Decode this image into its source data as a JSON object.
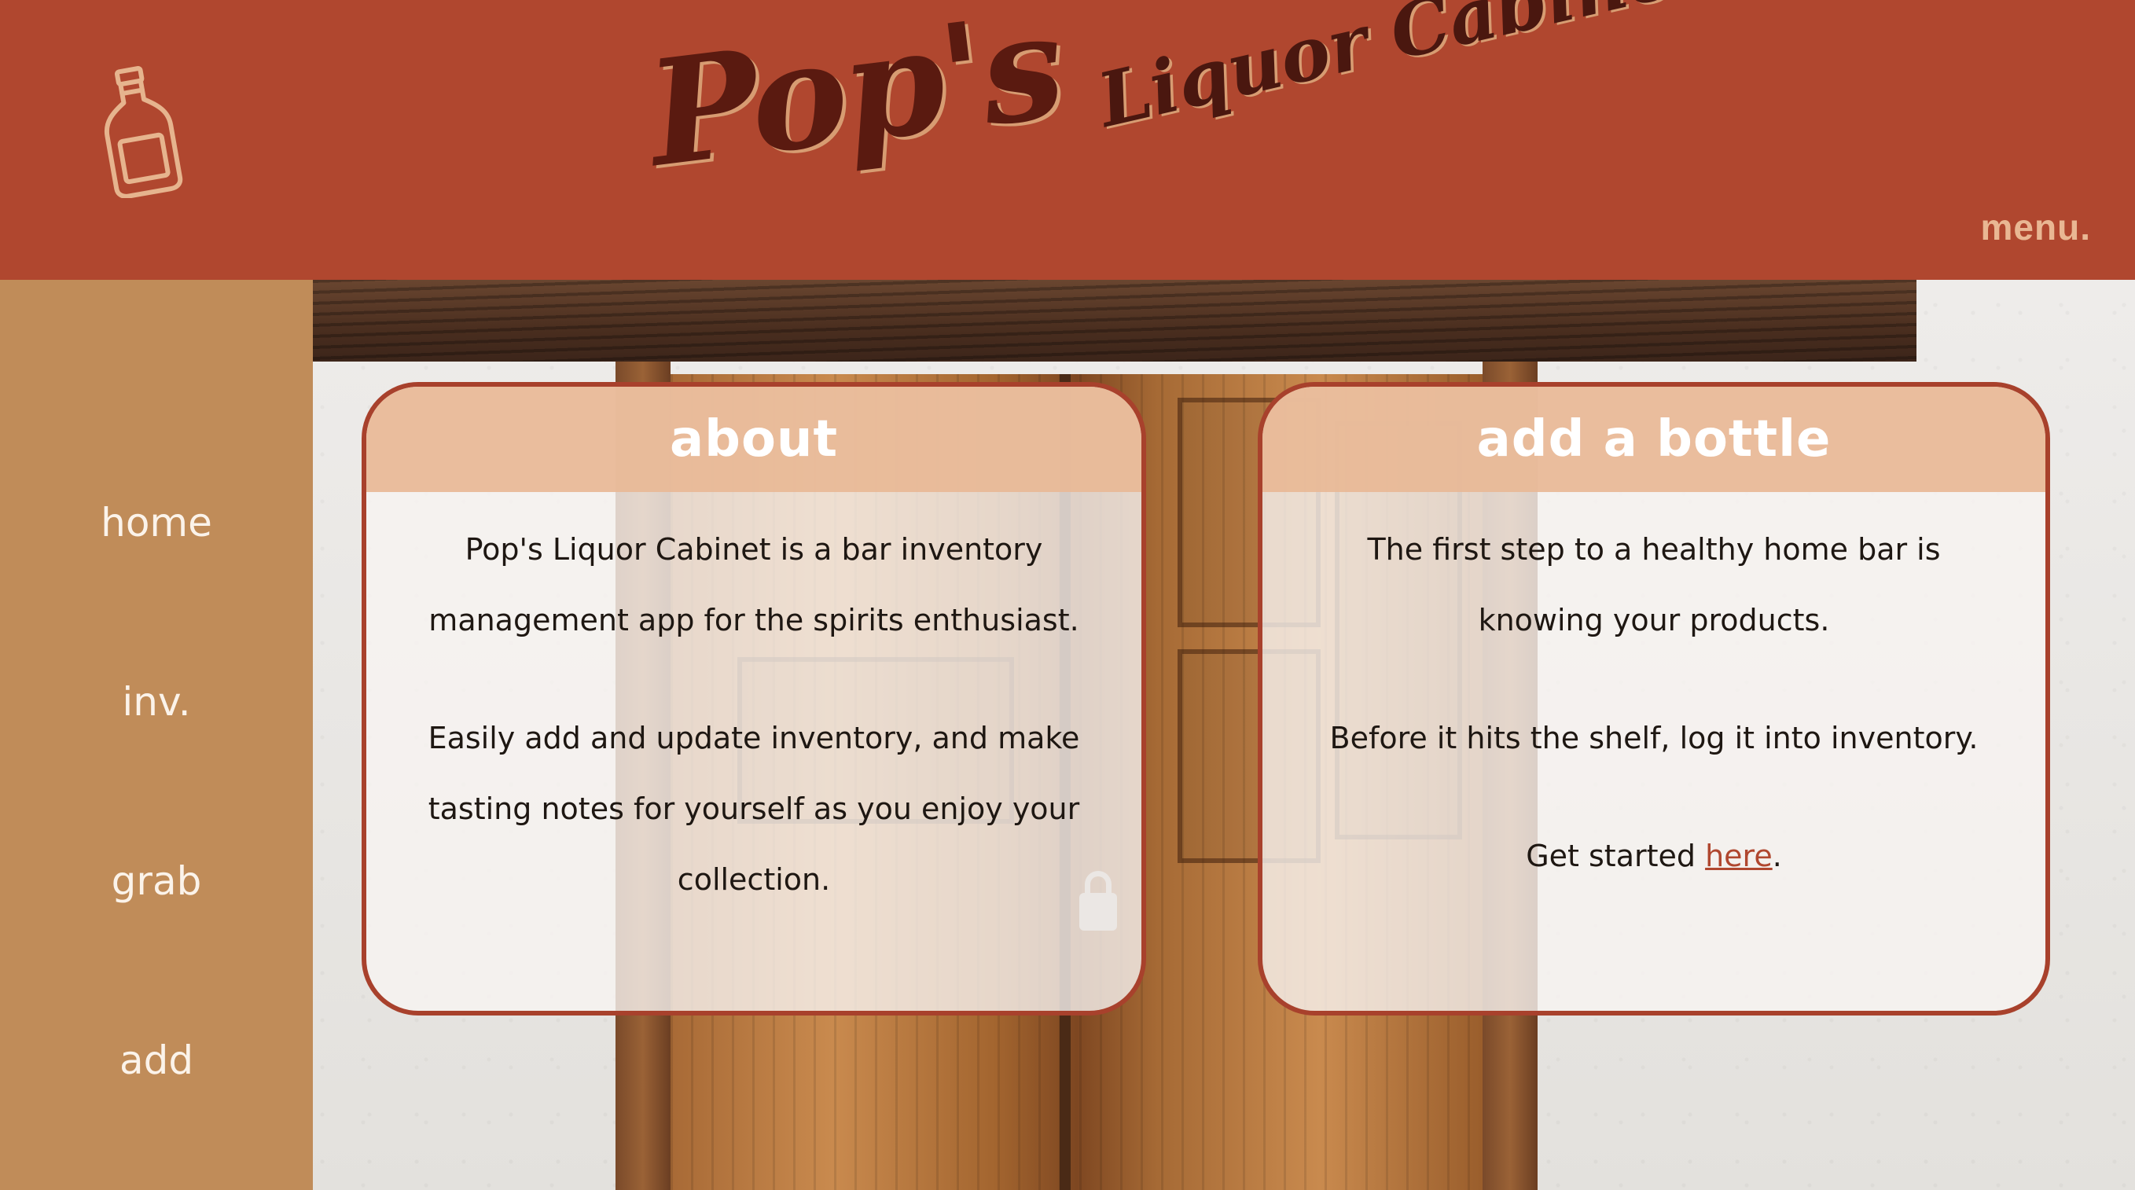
{
  "header": {
    "brand_main": "Pop's",
    "brand_sub": "Liquor Cabinet",
    "menu_label": "menu.",
    "logo_icon": "liquor-bottle-icon"
  },
  "sidebar": {
    "items": [
      {
        "label": "home"
      },
      {
        "label": "inv."
      },
      {
        "label": "grab"
      },
      {
        "label": "add"
      }
    ]
  },
  "cards": {
    "about": {
      "title": "about",
      "paragraphs": [
        "Pop's Liquor Cabinet is a bar inventory management app for the spirits enthusiast.",
        "Easily add and update inventory, and make tasting notes for yourself as you enjoy your collection."
      ]
    },
    "add": {
      "title": "add a bottle",
      "paragraphs": [
        "The first step to a healthy home bar is knowing your products.",
        "Before it hits the shelf, log it into inventory."
      ],
      "cta_prefix": "Get started ",
      "cta_link": "here",
      "cta_suffix": "."
    }
  },
  "colors": {
    "header_bg": "#b0472f",
    "sidebar_bg": "#c08c59",
    "card_border": "#a8412c",
    "card_header": "#e8b996",
    "link": "#b0472f"
  }
}
